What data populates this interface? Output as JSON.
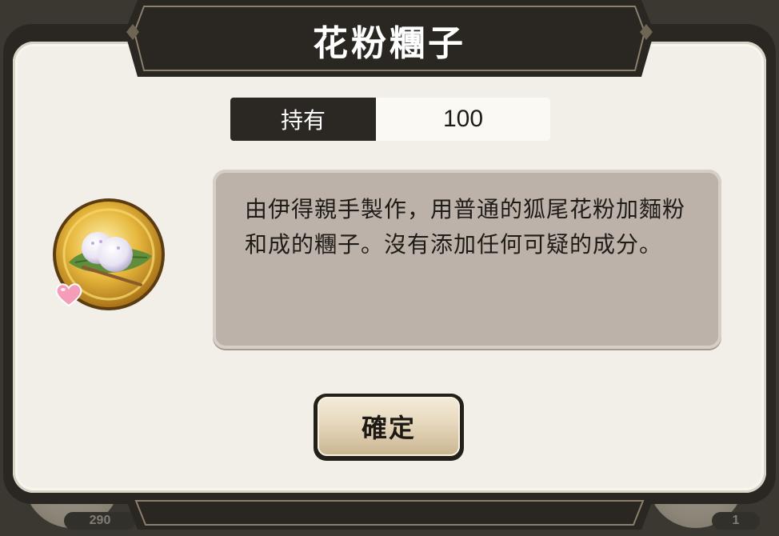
{
  "dialog": {
    "title": "花粉糰子"
  },
  "holding": {
    "label": "持有",
    "value": "100"
  },
  "item": {
    "icon_name": "dango-icon",
    "badge_icon": "heart-icon",
    "description": "由伊得親手製作，用普通的狐尾花粉加麵粉和成的糰子。沒有添加任何可疑的成分。"
  },
  "buttons": {
    "confirm_label": "確定"
  },
  "background": {
    "counts": [
      "290",
      "1"
    ]
  },
  "colors": {
    "frame": "#2a2622",
    "panel": "#f2efe8",
    "description_bg": "#bcb2aa",
    "holding_label_bg": "#2b2824",
    "coin_gold": "#d8a62a"
  }
}
